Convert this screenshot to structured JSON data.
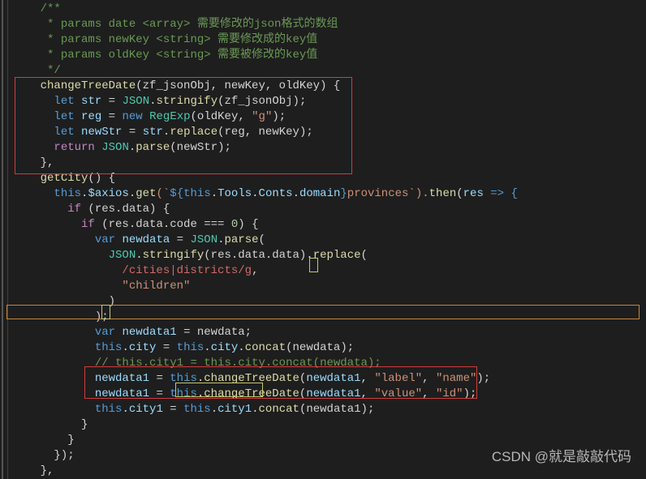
{
  "code": {
    "l1": "/**",
    "l2_a": " * params date <array> ",
    "l2_b": "需要修改的json格式的数组",
    "l3_a": " * params newKey <string> ",
    "l3_b": "需要修改成的key值",
    "l4_a": " * params oldKey <string> ",
    "l4_b": "需要被修改的key值",
    "l5": " */",
    "fn1_name": "changeTreeDate",
    "fn1_params": "(zf_jsonObj, newKey, oldKey) {",
    "let": "let",
    "str_var": "str",
    "eq": " = ",
    "json_cls": "JSON",
    "stringify": "stringify",
    "zf_arg": "(zf_jsonObj);",
    "reg_var": "reg",
    "new_kw": "new",
    "regexp": "RegExp",
    "regexp_args": "(oldKey, ",
    "g_str": "\"g\"",
    "close_paren": ");",
    "newstr_var": "newStr",
    "replace": "replace",
    "replace_args": "(reg, newKey);",
    "return": "return",
    "parse": "parse",
    "parse_args": "(newStr);",
    "brace_comma": "},",
    "fn2_name": "getCity",
    "fn2_params": "() {",
    "this": "this",
    "axios": "$axios",
    "get": "get",
    "tmpl_open": "(`",
    "tmpl_dollar": "${",
    "tools": "Tools",
    "conts": "Conts",
    "domain": "domain",
    "tmpl_close": "}",
    "provinces": "provinces",
    "tmpl_end": "`).",
    "then": "then",
    "res": "res",
    "arrow": " => {",
    "if": "if",
    "res_data": " (res.data) {",
    "res_code": " (res.data.code === ",
    "zero": "0",
    "close_if": ") {",
    "var": "var",
    "newdata": "newdata",
    "parse_open": "(",
    "str_chain": "(res.data.data).",
    "replace_open": "(",
    "regex_body": "/cities|districts/g",
    "comma": ",",
    "children": "\"children\"",
    "close_only": ")",
    "semicolon": ";",
    "newdata1": "newdata1",
    "eq_newdata": " = newdata;",
    "city": "city",
    "concat": "concat",
    "concat_newdata": "(newdata);",
    "comment_line": "// this.city1 = this.city.concat(newdata);",
    "label": "\"label\"",
    "name": "\"name\"",
    "value": "\"value\"",
    "id": "\"id\"",
    "city1": "city1",
    "concat_newdata1": "(newdata1);",
    "close_brace": "}",
    "close_bpr": "});"
  },
  "watermark": "CSDN @就是敲敲代码"
}
